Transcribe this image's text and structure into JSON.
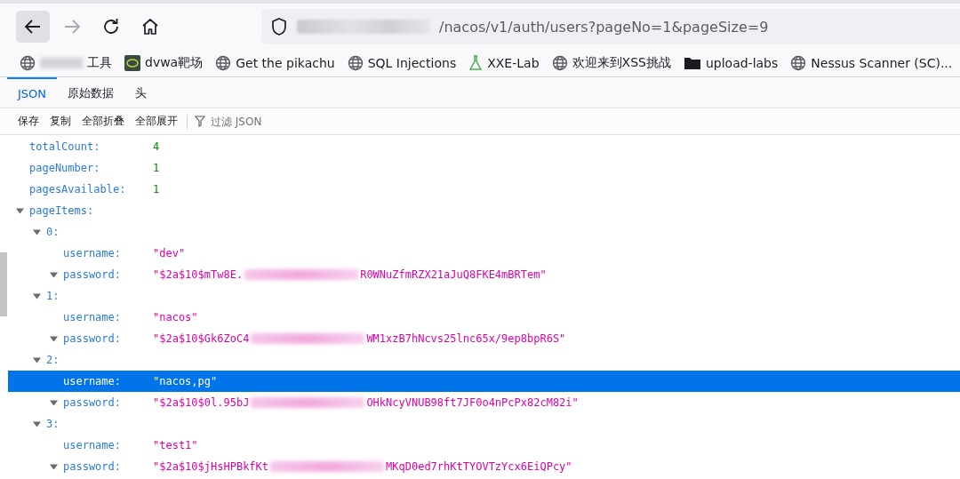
{
  "navigation": {
    "back": {
      "disabled": false,
      "hovered": true
    },
    "forward": {
      "disabled": true
    }
  },
  "address_bar": {
    "host_redacted": true,
    "url": "/nacos/v1/auth/users?pageNo=1&pageSize=9"
  },
  "bookmarks": [
    {
      "kind": "globe",
      "redacted_prefix": true,
      "label": "工具"
    },
    {
      "kind": "dvwa",
      "redacted_prefix": false,
      "label": "dvwa靶场"
    },
    {
      "kind": "globe",
      "redacted_prefix": false,
      "label": "Get the pikachu"
    },
    {
      "kind": "globe",
      "redacted_prefix": false,
      "label": "SQL Injections"
    },
    {
      "kind": "flask",
      "redacted_prefix": false,
      "label": "XXE-Lab"
    },
    {
      "kind": "globe",
      "redacted_prefix": false,
      "label": "欢迎来到XSS挑战"
    },
    {
      "kind": "folder",
      "redacted_prefix": false,
      "label": "upload-labs"
    },
    {
      "kind": "globe",
      "redacted_prefix": false,
      "label": "Nessus Scanner (SC)..."
    }
  ],
  "tabs": [
    {
      "label": "JSON",
      "selected": true
    },
    {
      "label": "原始数据",
      "selected": false
    },
    {
      "label": "头",
      "selected": false
    }
  ],
  "toolbar": {
    "buttons": [
      "保存",
      "复制",
      "全部折叠",
      "全部展开"
    ],
    "filter": {
      "placeholder": "过滤 JSON"
    }
  },
  "tree": [
    {
      "key": "totalCount:",
      "kind": "number",
      "value": "4",
      "selected": false
    },
    {
      "key": "pageNumber:",
      "kind": "number",
      "value": "1",
      "selected": false
    },
    {
      "key": "pagesAvailable:",
      "kind": "number",
      "value": "1",
      "selected": false
    },
    {
      "key": "pageItems:",
      "expanded": true,
      "selected": false,
      "children": [
        {
          "key": "0:",
          "expanded": true,
          "selected": false,
          "children": [
            {
              "key": "username:",
              "kind": "string",
              "value": "\"dev\"",
              "selected": false
            },
            {
              "key": "password:",
              "kind": "string",
              "expanded": true,
              "value": "\"$2a$10$mTw8E.",
              "redacted": true,
              "value_end": "R0WNuZfmRZX21aJuQ8FKE4mBRTem\"",
              "selected": false
            }
          ]
        },
        {
          "key": "1:",
          "expanded": true,
          "selected": false,
          "children": [
            {
              "key": "username:",
              "kind": "string",
              "value": "\"nacos\"",
              "selected": false
            },
            {
              "key": "password:",
              "kind": "string",
              "expanded": true,
              "value": "\"$2a$10$Gk6ZoC4",
              "redacted": true,
              "value_end": "WM1xzB7hNcvs25lnc65x/9ep8bpR6S\"",
              "selected": false
            }
          ]
        },
        {
          "key": "2:",
          "expanded": true,
          "selected": false,
          "children": [
            {
              "key": "username:",
              "kind": "string",
              "value": "\"nacos,pg\"",
              "selected": true
            },
            {
              "key": "password:",
              "kind": "string",
              "expanded": true,
              "value": "\"$2a$10$0l.95bJ",
              "redacted": true,
              "value_end": "OHkNcyVNUB98ft7JF0o4nPcPx82cM82i\"",
              "selected": false
            }
          ]
        },
        {
          "key": "3:",
          "expanded": true,
          "selected": false,
          "children": [
            {
              "key": "username:",
              "kind": "string",
              "value": "\"test1\"",
              "selected": false
            },
            {
              "key": "password:",
              "kind": "string",
              "expanded": true,
              "value": "\"$2a$10$jHsHPBkfKt",
              "redacted": true,
              "value_end": "MKqD0ed7rhKtTYOVTzYcx6EiQPcy\"",
              "selected": false
            }
          ]
        }
      ]
    }
  ]
}
